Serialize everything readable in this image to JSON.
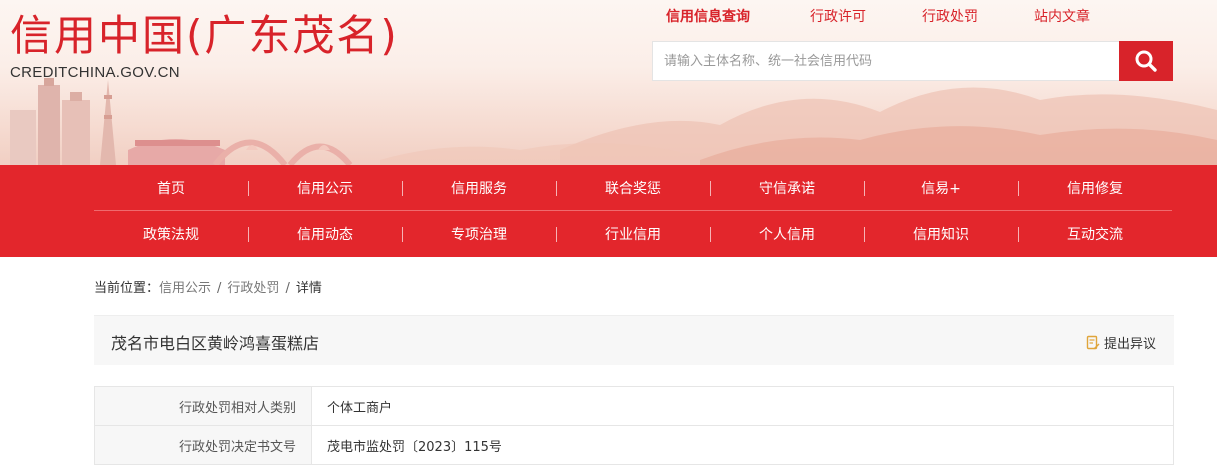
{
  "site": {
    "title_cn": "信用中国(广东茂名)",
    "domain": "CREDITCHINA.GOV.CN"
  },
  "top_tabs": [
    {
      "label": "信用信息查询",
      "active": true
    },
    {
      "label": "行政许可",
      "active": false
    },
    {
      "label": "行政处罚",
      "active": false
    },
    {
      "label": "站内文章",
      "active": false
    }
  ],
  "search": {
    "placeholder": "请输入主体名称、统一社会信用代码",
    "value": ""
  },
  "nav": {
    "row1": [
      "首页",
      "信用公示",
      "信用服务",
      "联合奖惩",
      "守信承诺",
      "信易+",
      "信用修复"
    ],
    "row2": [
      "政策法规",
      "信用动态",
      "专项治理",
      "行业信用",
      "个人信用",
      "信用知识",
      "互动交流"
    ]
  },
  "breadcrumb": {
    "prefix": "当前位置：",
    "items": [
      "信用公示",
      "行政处罚",
      "详情"
    ],
    "separator": "/"
  },
  "entity": {
    "name": "茂名市电白区黄岭鸿喜蛋糕店",
    "objection_label": "提出异议"
  },
  "details": [
    {
      "label": "行政处罚相对人类别",
      "value": "个体工商户"
    },
    {
      "label": "行政处罚决定书文号",
      "value": "茂电市监处罚〔2023〕115号"
    }
  ],
  "colors": {
    "brand_red": "#d8232a",
    "nav_red": "#e3262c"
  }
}
